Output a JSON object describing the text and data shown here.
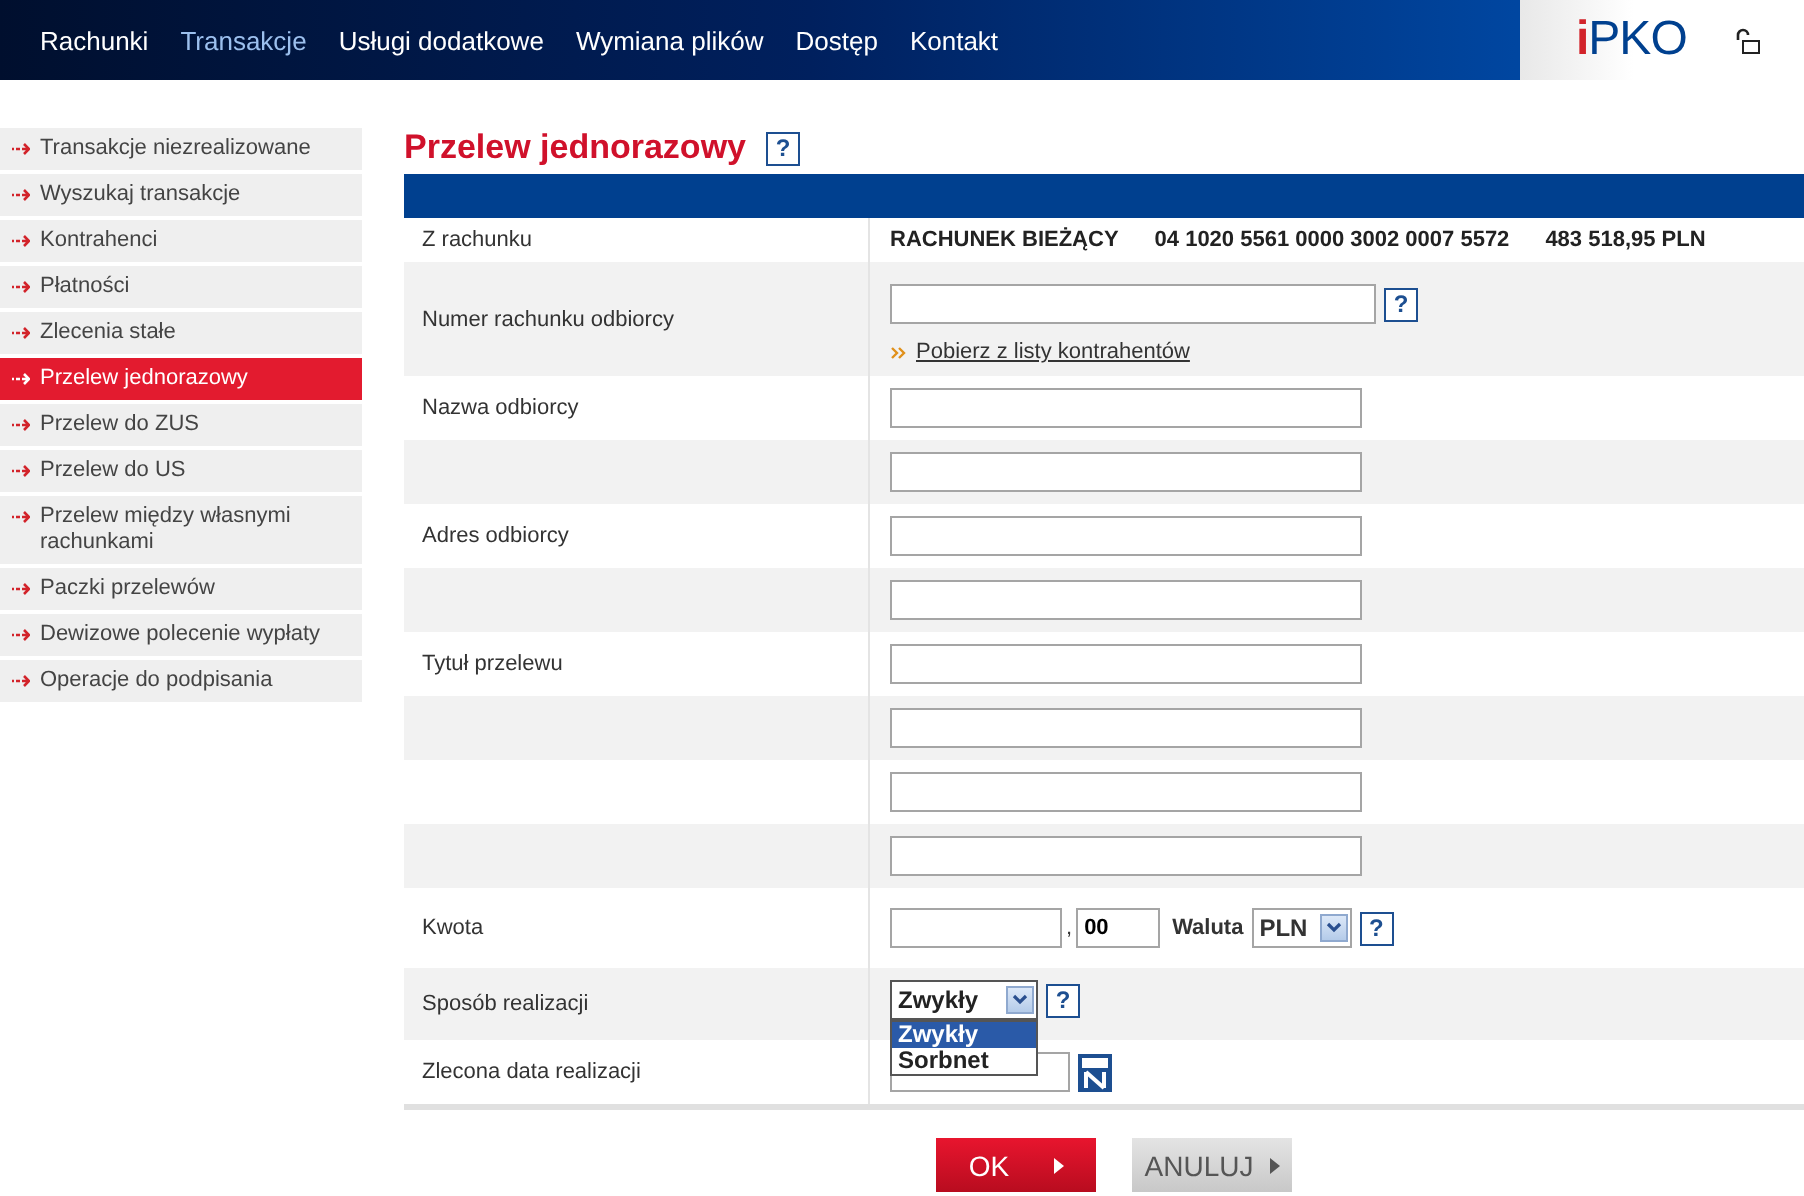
{
  "nav": {
    "items": [
      {
        "label": "Rachunki",
        "selected": false
      },
      {
        "label": "Transakcje",
        "selected": true
      },
      {
        "label": "Usługi dodatkowe",
        "selected": false
      },
      {
        "label": "Wymiana plików",
        "selected": false
      },
      {
        "label": "Dostęp",
        "selected": false
      },
      {
        "label": "Kontakt",
        "selected": false
      }
    ],
    "logo": "iPKO"
  },
  "sidebar": {
    "items": [
      {
        "label": "Transakcje niezrealizowane",
        "selected": false
      },
      {
        "label": "Wyszukaj transakcje",
        "selected": false
      },
      {
        "label": "Kontrahenci",
        "selected": false
      },
      {
        "label": "Płatności",
        "selected": false
      },
      {
        "label": "Zlecenia stałe",
        "selected": false
      },
      {
        "label": "Przelew jednorazowy",
        "selected": true
      },
      {
        "label": "Przelew do ZUS",
        "selected": false
      },
      {
        "label": "Przelew do US",
        "selected": false
      },
      {
        "label": "Przelew między własnymi rachunkami",
        "selected": false
      },
      {
        "label": "Paczki przelewów",
        "selected": false
      },
      {
        "label": "Dewizowe polecenie wypłaty",
        "selected": false
      },
      {
        "label": "Operacje do podpisania",
        "selected": false
      }
    ]
  },
  "form": {
    "title": "Przelew jednorazowy",
    "help": "?",
    "rows": [
      {
        "kind": "account",
        "label": "Z rachunku",
        "account_name": "RACHUNEK BIEŻĄCY",
        "account_number": "04 1020 5561 0000 3002 0007 5572",
        "balance": "483 518,95 PLN"
      },
      {
        "kind": "account-input",
        "label": "Numer rachunku odbiorcy",
        "help": "?",
        "link": "Pobierz z listy kontrahentów"
      },
      {
        "kind": "text",
        "label": "Nazwa odbiorcy"
      },
      {
        "kind": "text"
      },
      {
        "kind": "text",
        "label": "Adres odbiorcy"
      },
      {
        "kind": "text"
      },
      {
        "kind": "text",
        "label": "Tytuł przelewu"
      },
      {
        "kind": "text"
      },
      {
        "kind": "text"
      },
      {
        "kind": "text"
      },
      {
        "kind": "amount",
        "label": "Kwota",
        "separator": ",",
        "cents": "00",
        "currency_label": "Waluta",
        "currency": "PLN",
        "help": "?"
      },
      {
        "kind": "select",
        "label": "Sposób realizacji",
        "value": "Zwykły",
        "expanded": true,
        "help": "?",
        "options": [
          {
            "label": "Zwykły",
            "selected": true
          },
          {
            "label": "Sorbnet",
            "selected": false
          }
        ]
      },
      {
        "kind": "date",
        "label": "Zlecona data realizacji"
      }
    ]
  },
  "buttons": [
    {
      "label": "OK",
      "kind": "primary"
    },
    {
      "label": "ANULUJ",
      "kind": "secondary"
    }
  ]
}
